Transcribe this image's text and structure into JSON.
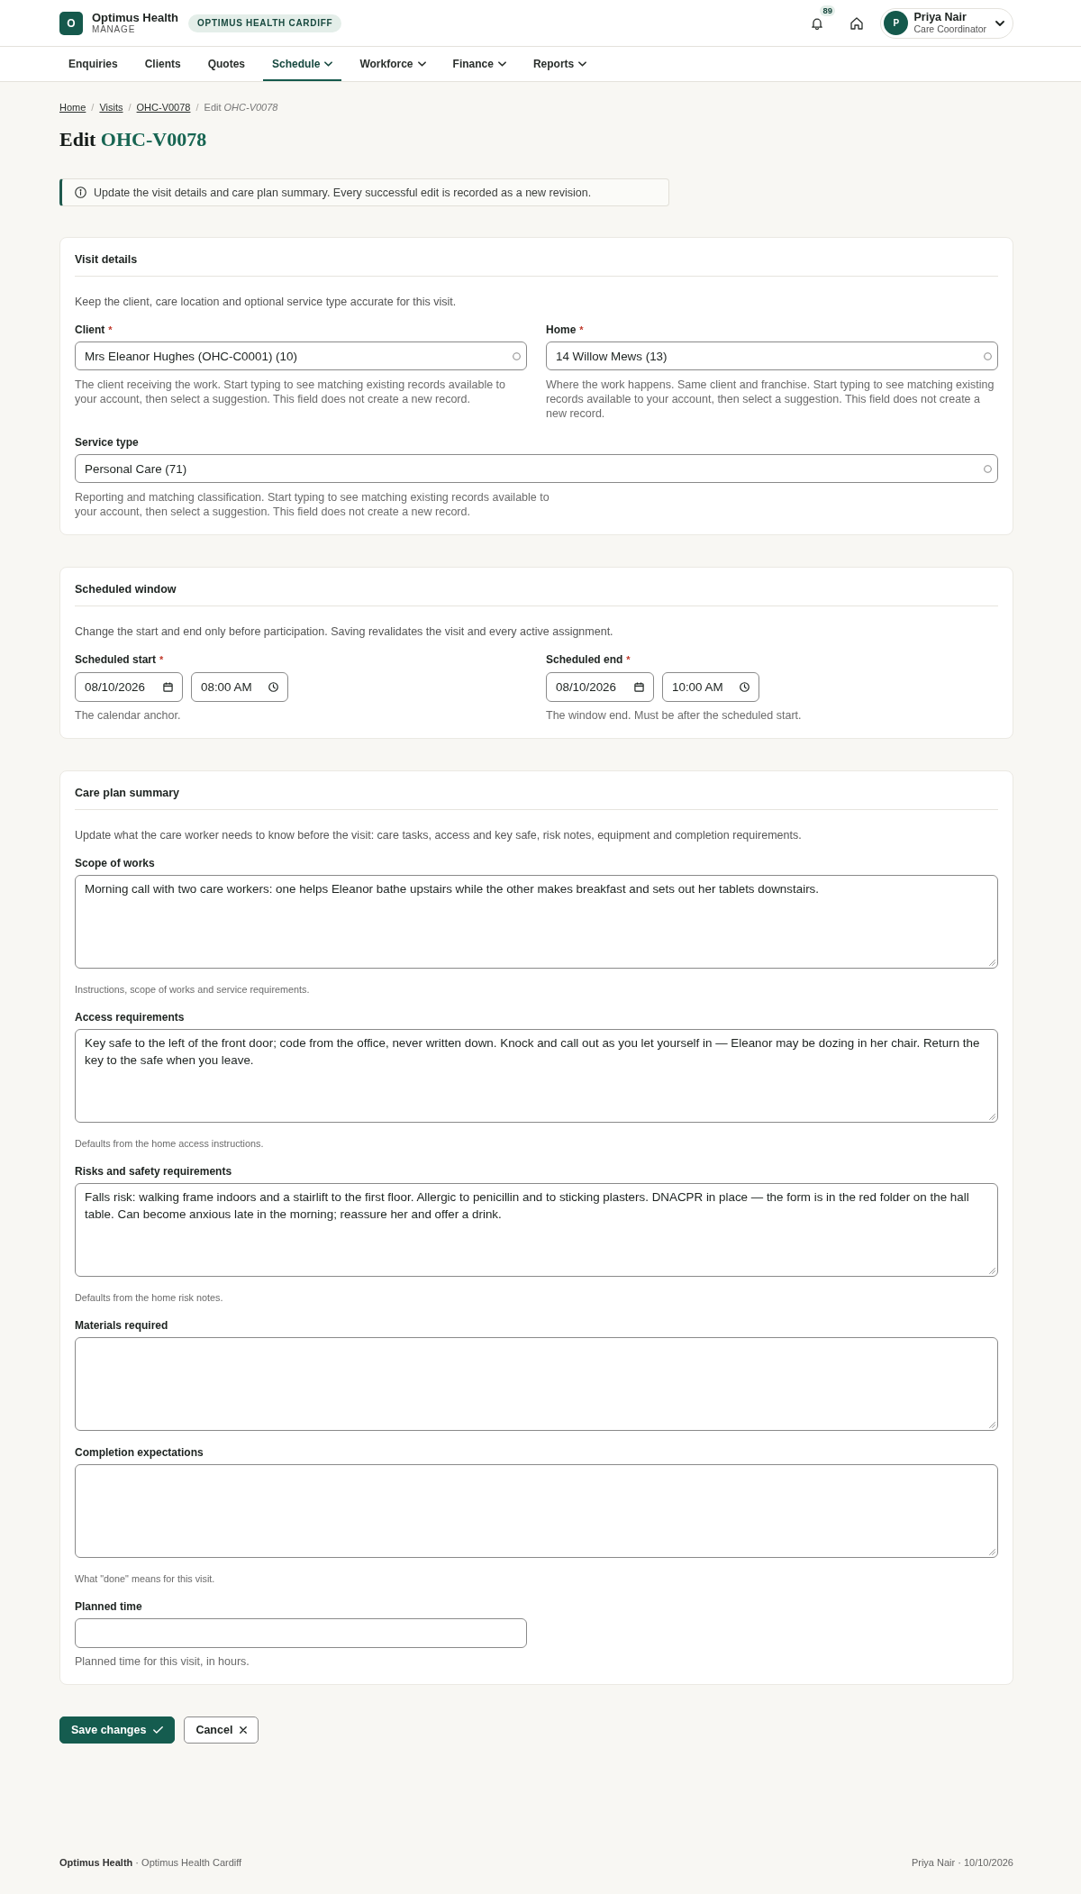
{
  "header": {
    "logo_letter": "O",
    "brand_name": "Optimus Health",
    "brand_subtitle": "MANAGE",
    "org_badge": "OPTIMUS HEALTH CARDIFF",
    "notification_count": "89",
    "user": {
      "avatar_letter": "P",
      "name": "Priya Nair",
      "role": "Care Coordinator"
    }
  },
  "nav": [
    {
      "label": "Enquiries",
      "selected": false,
      "has_menu": false
    },
    {
      "label": "Clients",
      "selected": false,
      "has_menu": false
    },
    {
      "label": "Quotes",
      "selected": false,
      "has_menu": false
    },
    {
      "label": "Schedule",
      "selected": true,
      "has_menu": true
    },
    {
      "label": "Workforce",
      "selected": false,
      "has_menu": true
    },
    {
      "label": "Finance",
      "selected": false,
      "has_menu": true
    },
    {
      "label": "Reports",
      "selected": false,
      "has_menu": true
    }
  ],
  "breadcrumb": [
    {
      "kind": "link",
      "label": "Home"
    },
    {
      "kind": "separator",
      "label": "/"
    },
    {
      "kind": "link",
      "label": "Visits"
    },
    {
      "kind": "separator",
      "label": "/"
    },
    {
      "kind": "link",
      "label": "OHC-V0078"
    },
    {
      "kind": "separator",
      "label": "/"
    },
    {
      "kind": "current",
      "label": "Edit *OHC-V0078*"
    }
  ],
  "title": {
    "action": "Edit",
    "record": "OHC-V0078"
  },
  "notice": "Update the visit details and care plan summary. Every successful edit is recorded as a new revision.",
  "sections": [
    {
      "title": "Visit details",
      "description": "Keep the client, care location and optional service type accurate for this visit.",
      "rows": [
        [
          {
            "kind": "lookup",
            "label": "Client",
            "required_mark": "*",
            "value": "Mrs Eleanor Hughes (OHC-C0001) (10)",
            "help": "The client receiving the work. Start typing to see matching existing records available to your account, then select a suggestion. This field does not create a new record."
          },
          {
            "kind": "lookup",
            "label": "Home",
            "required_mark": "*",
            "value": "14 Willow Mews (13)",
            "help": "Where the work happens. Same client and franchise. Start typing to see matching existing records available to your account, then select a suggestion. This field does not create a new record."
          }
        ],
        [
          {
            "kind": "lookup",
            "label": "Service type",
            "value": "Personal Care (71)",
            "help": "Reporting and matching classification. Start typing to see matching existing records available to your account, then select a suggestion. This field does not create a new record."
          }
        ]
      ]
    },
    {
      "title": "Scheduled window",
      "description": "Change the start and end only before participation. Saving revalidates the visit and every active assignment.",
      "rows": [
        [
          {
            "kind": "datetime",
            "label": "Scheduled start",
            "required_mark": "*",
            "date": "08/10/2026",
            "time": "08:00 AM",
            "help": "The calendar anchor."
          },
          {
            "kind": "datetime",
            "label": "Scheduled end",
            "required_mark": "*",
            "date": "08/10/2026",
            "time": "10:00 AM",
            "help": "The window end. Must be after the scheduled start."
          }
        ]
      ]
    },
    {
      "title": "Care plan summary",
      "description": "Update what the care worker needs to know before the visit: care tasks, access and key safe, risk notes, equipment and completion requirements.",
      "rows": [
        [
          {
            "kind": "textarea",
            "label": "Scope of works",
            "value": "Morning call with two care workers: one helps Eleanor bathe upstairs while the other makes breakfast and sets out her tablets downstairs.",
            "help": "Instructions, scope of works and service requirements."
          }
        ],
        [
          {
            "kind": "textarea",
            "label": "Access requirements",
            "value": "Key safe to the left of the front door; code from the office, never written down. Knock and call out as you let yourself in — Eleanor may be dozing in her chair. Return the key to the safe when you leave.",
            "help": "Defaults from the home access instructions."
          }
        ],
        [
          {
            "kind": "textarea",
            "label": "Risks and safety requirements",
            "value": "Falls risk: walking frame indoors and a stairlift to the first floor. Allergic to penicillin and to sticking plasters. DNACPR in place — the form is in the red folder on the hall table. Can become anxious late in the morning; reassure her and offer a drink.",
            "help": "Defaults from the home risk notes."
          }
        ],
        [
          {
            "kind": "textarea",
            "label": "Materials required"
          }
        ],
        [
          {
            "kind": "textarea",
            "label": "Completion expectations",
            "help": "What \"done\" means for this visit."
          }
        ],
        [
          {
            "kind": "number",
            "label": "Planned time",
            "help": "Planned time for this visit, in hours."
          }
        ]
      ]
    }
  ],
  "actions": [
    {
      "kind": "primary",
      "label": "Save changes"
    },
    {
      "kind": "secondary",
      "label": "Cancel"
    }
  ],
  "footer": {
    "left": "**Optimus Health** · Optimus Health Cardiff",
    "right": "Priya Nair · 10/10/2026"
  }
}
